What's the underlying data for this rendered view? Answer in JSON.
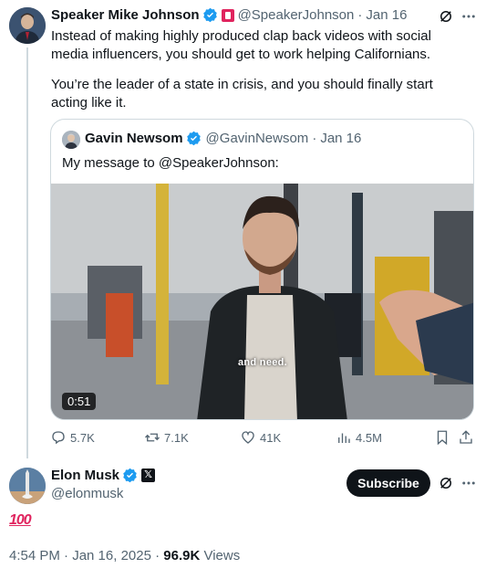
{
  "quoted_tweet": {
    "author_name": "Speaker Mike Johnson",
    "handle": "@SpeakerJohnson",
    "separator": "·",
    "date": "Jan 16",
    "text_p1": "Instead of making highly produced clap back videos with social media influencers, you should get to work helping Californians.",
    "text_p2": "You’re the leader of a state in crisis, and you should finally start acting like it.",
    "quote": {
      "author_name": "Gavin Newsom",
      "handle": "@GavinNewsom",
      "separator": "·",
      "date": "Jan 16",
      "text": "My message to @SpeakerJohnson:",
      "video_time": "0:51",
      "video_caption": "and need."
    },
    "actions": {
      "replies": "5.7K",
      "reposts": "7.1K",
      "likes": "41K",
      "views": "4.5M"
    }
  },
  "main_tweet": {
    "author_name": "Elon Musk",
    "handle": "@elonmusk",
    "x_badge": "𝕏",
    "subscribe_label": "Subscribe",
    "emoji_text": "100",
    "time": "4:54 PM · Jan 16, 2025 · ",
    "views_count": "96.9K",
    "views_label": " Views"
  },
  "colors": {
    "verified": "#1d9bf0",
    "text": "#0f1419",
    "muted": "#536471",
    "border": "#cfd9de",
    "hundred_red": "#e0245e"
  }
}
